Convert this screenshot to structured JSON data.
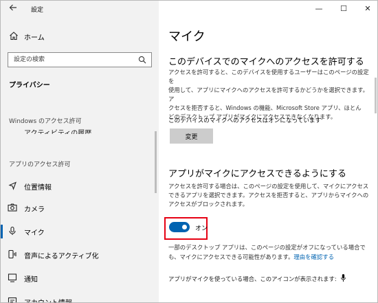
{
  "left": {
    "back_icon": "arrow-left-icon",
    "title": "設定",
    "home_label": "ホーム",
    "search_placeholder": "設定の検索",
    "privacy_label": "プライバシー",
    "section_windows": "Windows のアクセス許可",
    "cut_item": "アクティビティの履歴",
    "section_apps": "アプリのアクセス許可",
    "nav": [
      {
        "label": "位置情報",
        "icon": "location-icon"
      },
      {
        "label": "カメラ",
        "icon": "camera-icon"
      },
      {
        "label": "マイク",
        "icon": "microphone-icon",
        "active": true
      },
      {
        "label": "音声によるアクティブ化",
        "icon": "voice-activation-icon"
      },
      {
        "label": "通知",
        "icon": "notification-icon"
      },
      {
        "label": "アカウント情報",
        "icon": "account-icon"
      }
    ]
  },
  "window_controls": {
    "minimize": "—",
    "maximize": "☐",
    "close": "✕"
  },
  "main": {
    "title": "マイク",
    "device_heading": "このデバイスでのマイクへのアクセスを許可する",
    "device_para": [
      "アクセスを許可すると、このデバイスを使用するユーザーはこのページの設定を",
      "使用して、アプリにマイクへのアクセスを許可するかどうかを選択できます。ア",
      "クセスを拒否すると、Windows の機能、Microsoft Store アプリ、ほとん",
      "どのデスクトップ アプリがマイクにアクセスできなくなります。"
    ],
    "device_status": "このデバイスのマイクへのアクセスはオンになっています",
    "change_button": "変更",
    "apps_heading": "アプリがマイクにアクセスできるようにする",
    "apps_para": [
      "アクセスを許可する場合は、このページの設定を使用して、マイクにアクセス",
      "できるアプリを選択できます。アクセスを拒否すると、アプリからマイクへの",
      "アクセスがブロックされます。"
    ],
    "toggle": {
      "state": "on",
      "label": "オン"
    },
    "desktop_para_1": "一部のデスクトップ アプリは、このページの設定がオフになっている場合で",
    "desktop_para_2": "も、マイクにアクセスできる可能性があります。",
    "desktop_link": "理由を確認する",
    "mic_in_use_text": "アプリがマイクを使っている場合、このアイコンが表示されます:"
  },
  "colors": {
    "accent": "#0063b1",
    "highlight": "#e60012",
    "sidebar_bg": "#f2f2f2"
  }
}
